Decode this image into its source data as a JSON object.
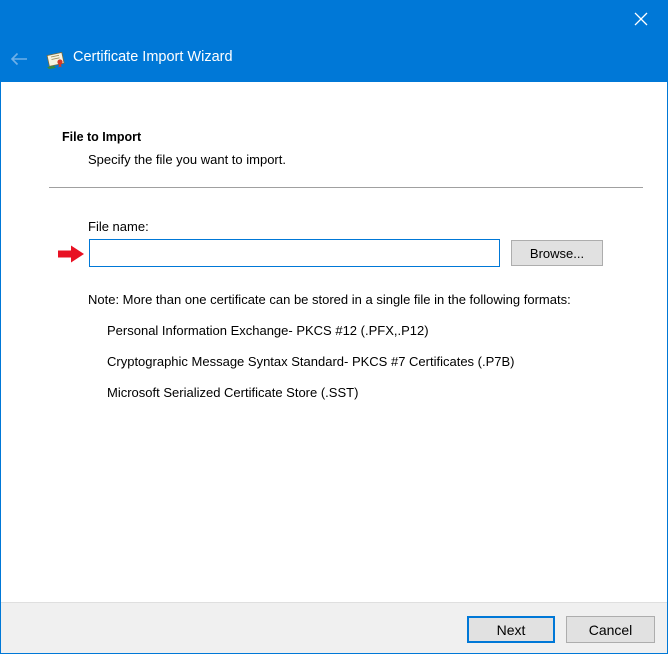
{
  "window": {
    "title": "Certificate Import Wizard",
    "accent_color": "#0078d7",
    "icons": {
      "close": "close-icon",
      "back": "back-arrow-icon",
      "title": "certificate-icon"
    }
  },
  "section": {
    "title": "File to Import",
    "description": "Specify the file you want to import."
  },
  "file_field": {
    "label": "File name:",
    "value": "",
    "placeholder": ""
  },
  "browse_button": {
    "label": "Browse..."
  },
  "note": {
    "text": "Note:  More than one certificate can be stored in a single file in the following formats:",
    "formats": [
      "Personal Information Exchange- PKCS #12 (.PFX,.P12)",
      "Cryptographic Message Syntax Standard- PKCS #7 Certificates (.P7B)",
      "Microsoft Serialized Certificate Store (.SST)"
    ]
  },
  "annotation": {
    "icon": "red-arrow-icon",
    "color": "#e81123"
  },
  "footer": {
    "next_label": "Next",
    "cancel_label": "Cancel"
  }
}
